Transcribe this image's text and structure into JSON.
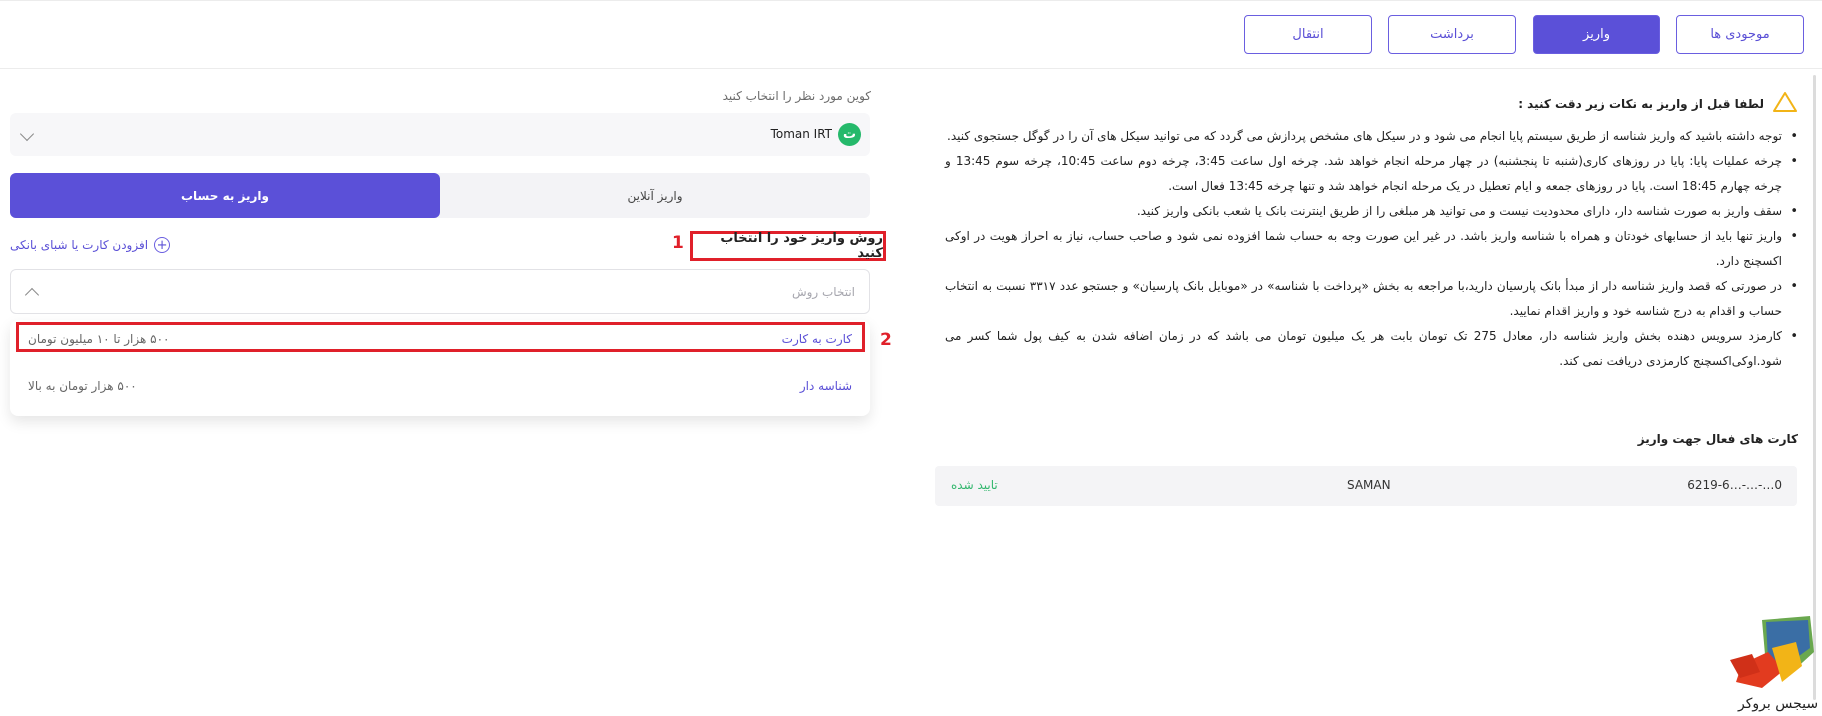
{
  "tabs": {
    "balances": "موجودی ها",
    "deposit": "واریز",
    "withdraw": "برداشت",
    "transfer": "انتقال"
  },
  "notice": {
    "title": "لطفا قبل از واریز به نکات زیر دقت کنید :",
    "items": [
      "توجه داشته باشید که واریز شناسه از طریق سیستم پایا انجام می شود و در سیکل های مشخص پردازش می گردد که می توانید سیکل های آن را در گوگل جستجوی کنید.",
      "چرخه عملیات پایا: پایا در روزهای کاری(شنبه تا پنجشنبه) در چهار مرحله انجام خواهد شد. چرخه اول ساعت 3:45، چرخه دوم ساعت 10:45، چرخه سوم 13:45 و چرخه چهارم 18:45 است. پایا در روزهای جمعه و ایام تعطیل در یک مرحله انجام خواهد شد و تنها چرخه 13:45 فعال است.",
      "سقف واریز به صورت شناسه دار، دارای محدودیت نیست و می توانید هر مبلغی را از طریق اینترنت بانک یا شعب بانکی واریز کنید.",
      "واریز تنها باید از حسابهای خودتان و همراه با شناسه واریز باشد. در غیر این صورت وجه به حساب شما افزوده نمی شود و صاحب حساب، نیاز به احراز هویت در اوکی اکسچنج دارد.",
      "در صورتی که قصد واریز شناسه دار از مبدأ بانک پارسیان دارید،با مراجعه به بخش «پرداخت با شناسه» در «موبایل بانک پارسیان» و جستجو عدد ۳۳۱۷ نسبت به انتخاب حساب و اقدام به درج شناسه خود و واریز اقدام نمایید.",
      "کارمزد سرویس دهنده بخش واریز شناسه دار، معادل 275 تک تومان بابت هر یک میلیون تومان می باشد که در زمان اضافه شدن به کیف پول شما کسر می شود.اوکی‌اکسچنج کارمزدی دریافت نمی کند."
    ]
  },
  "active_cards": {
    "title": "کارت های فعال جهت واریز",
    "card": {
      "number": "6219-6…-…-…0",
      "bank": "SAMAN",
      "status": "تایید شده"
    }
  },
  "form": {
    "coin_label": "کوین مورد نظر را انتخاب کنید",
    "coin_badge": "ت",
    "coin_name": "Toman IRT",
    "method_online": "واریز آنلاین",
    "method_account": "واریز به حساب",
    "choose_method": "روش واریز خود را انتخاب کنید",
    "add_card": "افزودن کارت یا شبای بانکی",
    "select_placeholder": "انتخاب روش",
    "options": [
      {
        "name": "کارت به کارت",
        "range": "۵۰۰ هزار تا ۱۰ میلیون تومان"
      },
      {
        "name": "شناسه دار",
        "range": "۵۰۰ هزار تومان به بالا"
      }
    ]
  },
  "annotations": {
    "one": "1",
    "two": "2"
  },
  "watermark": {
    "text": "سیجس بروکر"
  },
  "colors": {
    "accent": "#5b50d8",
    "success": "#33b76e",
    "highlight": "#e0202a",
    "warning": "#f2b417"
  }
}
